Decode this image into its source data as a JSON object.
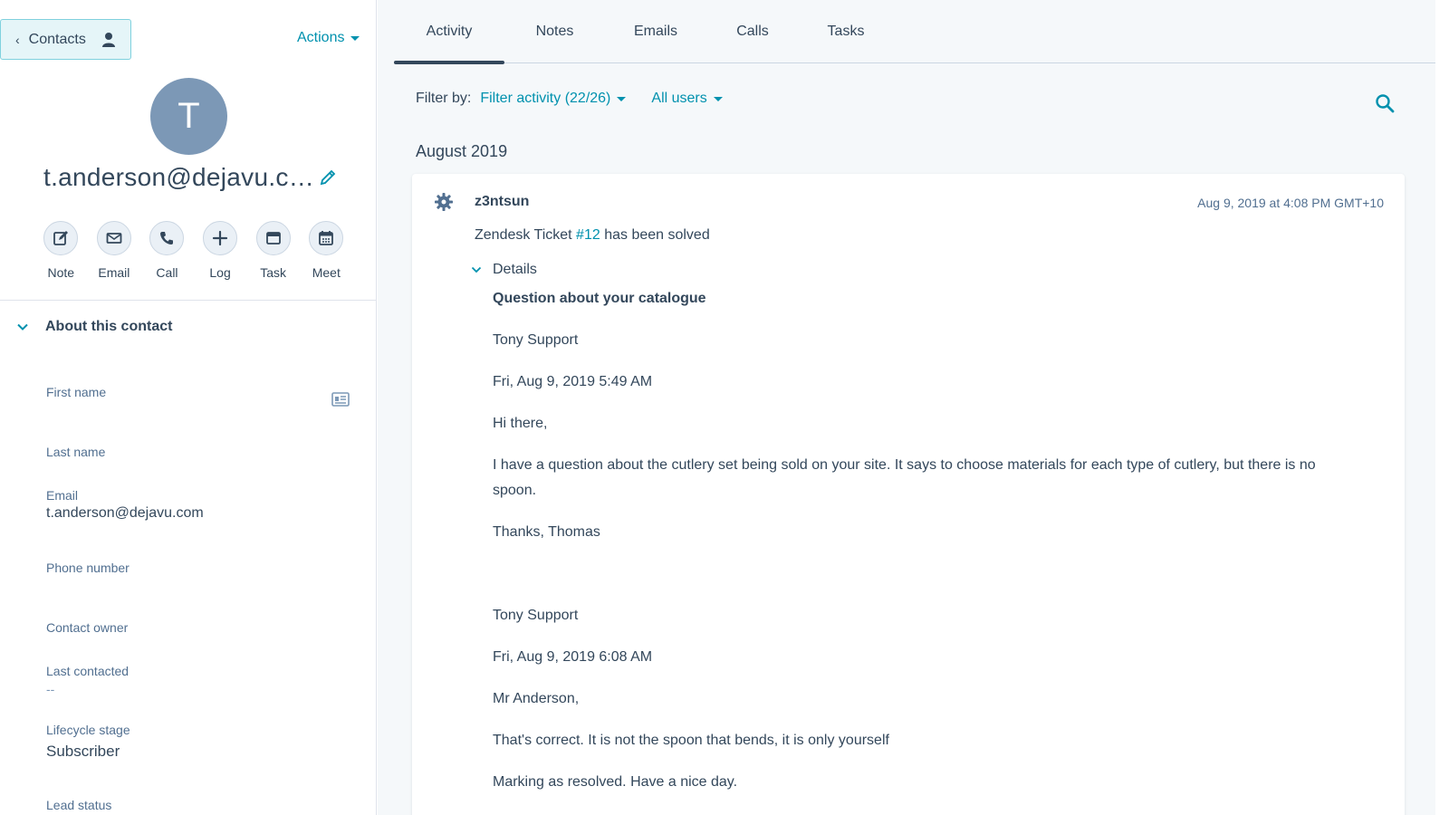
{
  "sidebar": {
    "back_label": "Contacts",
    "actions_label": "Actions",
    "avatar_initial": "T",
    "contact_name": "t.anderson@dejavu.com",
    "quick_actions": [
      {
        "label": "Note",
        "icon": "note-icon"
      },
      {
        "label": "Email",
        "icon": "email-icon"
      },
      {
        "label": "Call",
        "icon": "call-icon"
      },
      {
        "label": "Log",
        "icon": "log-icon"
      },
      {
        "label": "Task",
        "icon": "task-icon"
      },
      {
        "label": "Meet",
        "icon": "meet-icon"
      }
    ],
    "about_title": "About this contact",
    "properties": [
      {
        "label": "First name",
        "value": ""
      },
      {
        "label": "Last name",
        "value": ""
      },
      {
        "label": "Email",
        "value": "t.anderson@dejavu.com"
      },
      {
        "label": "Phone number",
        "value": ""
      },
      {
        "label": "Contact owner",
        "value": ""
      },
      {
        "label": "Last contacted",
        "value": "--"
      },
      {
        "label": "Lifecycle stage",
        "value": "Subscriber"
      },
      {
        "label": "Lead status",
        "value": ""
      }
    ]
  },
  "tabs": [
    "Activity",
    "Notes",
    "Emails",
    "Calls",
    "Tasks"
  ],
  "filter": {
    "label": "Filter by:",
    "activity": "Filter activity (22/26)",
    "users": "All users"
  },
  "month": "August 2019",
  "activity": {
    "author": "z3ntsun",
    "timestamp": "Aug 9, 2019 at 4:08 PM GMT+10",
    "headline_prefix": "Zendesk Ticket ",
    "headline_link": "#12",
    "headline_suffix": " has been solved",
    "details_label": "Details",
    "subject": "Question about your catalogue",
    "lines": [
      "Tony Support",
      "Fri, Aug 9, 2019 5:49 AM",
      "Hi there,",
      "I have a question about the cutlery set being sold on your site. It says to choose materials for each type of cutlery, but there is no spoon.",
      "Thanks, Thomas",
      "Tony Support",
      "Fri, Aug 9, 2019 6:08 AM",
      "Mr Anderson,",
      "That's correct. It is not the spoon that bends, it is only yourself",
      "Marking as resolved. Have a nice day."
    ]
  },
  "colors": {
    "accent": "#0091ae",
    "text": "#33475b",
    "avatar": "#7c98b6",
    "panel_bg": "#f5f8fa"
  }
}
